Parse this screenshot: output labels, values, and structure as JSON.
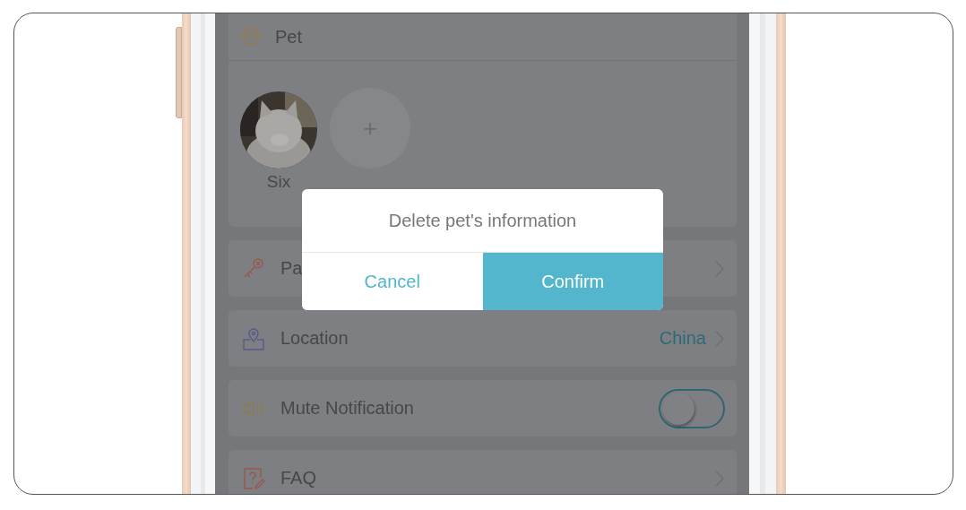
{
  "pet_section": {
    "title": "Pet",
    "pets": [
      {
        "name": "Six",
        "kind": "picture"
      }
    ],
    "add_button": "+"
  },
  "rows": [
    {
      "kind": "link",
      "label": "Pa"
    },
    {
      "kind": "link",
      "label": "Location",
      "value": "China"
    },
    {
      "kind": "toggle",
      "label": "Mute Notification",
      "on": false
    },
    {
      "kind": "link",
      "label": "FAQ"
    }
  ],
  "dialog": {
    "message": "Delete pet's information",
    "buttons": [
      {
        "label": "Cancel",
        "kind": "secondary"
      },
      {
        "label": "Confirm",
        "kind": "primary"
      }
    ]
  }
}
